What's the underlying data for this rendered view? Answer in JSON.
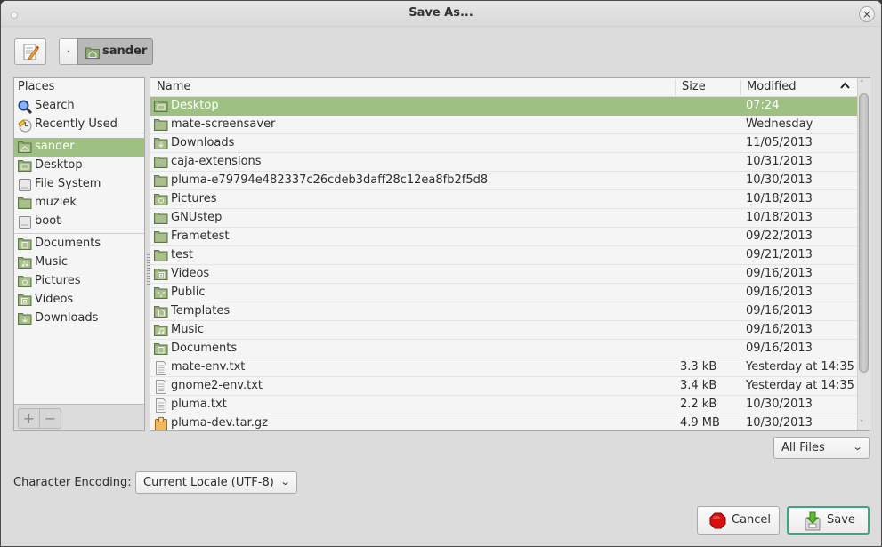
{
  "window": {
    "title": "Save As..."
  },
  "path_bar": {
    "back_label": "‹",
    "current_folder": "sander"
  },
  "places": {
    "header": "Places",
    "items": [
      {
        "label": "Search",
        "icon": "search-icon",
        "selected": false
      },
      {
        "label": "Recently Used",
        "icon": "recent-icon",
        "selected": false
      },
      {
        "label": "sander",
        "icon": "home-folder-icon",
        "selected": true
      },
      {
        "label": "Desktop",
        "icon": "desktop-folder-icon",
        "selected": false
      },
      {
        "label": "File System",
        "icon": "drive-icon",
        "selected": false
      },
      {
        "label": "muziek",
        "icon": "folder-icon",
        "selected": false
      },
      {
        "label": "boot",
        "icon": "drive-icon",
        "selected": false
      },
      {
        "label": "Documents",
        "icon": "documents-folder-icon",
        "selected": false
      },
      {
        "label": "Music",
        "icon": "music-folder-icon",
        "selected": false
      },
      {
        "label": "Pictures",
        "icon": "pictures-folder-icon",
        "selected": false
      },
      {
        "label": "Videos",
        "icon": "videos-folder-icon",
        "selected": false
      },
      {
        "label": "Downloads",
        "icon": "downloads-folder-icon",
        "selected": false
      }
    ],
    "add_label": "+",
    "remove_label": "−"
  },
  "file_list": {
    "columns": {
      "name": "Name",
      "size": "Size",
      "modified": "Modified"
    },
    "sort_indicator": "^",
    "rows": [
      {
        "name": "Desktop",
        "size": "",
        "modified": "07:24",
        "icon": "desktop-folder-icon",
        "selected": true
      },
      {
        "name": "mate-screensaver",
        "size": "",
        "modified": "Wednesday",
        "icon": "folder-icon",
        "selected": false
      },
      {
        "name": "Downloads",
        "size": "",
        "modified": "11/05/2013",
        "icon": "downloads-folder-icon",
        "selected": false
      },
      {
        "name": "caja-extensions",
        "size": "",
        "modified": "10/31/2013",
        "icon": "folder-icon",
        "selected": false
      },
      {
        "name": "pluma-e79794e482337c26cdeb3daff28c12ea8fb2f5d8",
        "size": "",
        "modified": "10/30/2013",
        "icon": "folder-icon",
        "selected": false
      },
      {
        "name": "Pictures",
        "size": "",
        "modified": "10/18/2013",
        "icon": "pictures-folder-icon",
        "selected": false
      },
      {
        "name": "GNUstep",
        "size": "",
        "modified": "10/18/2013",
        "icon": "folder-icon",
        "selected": false
      },
      {
        "name": "Frametest",
        "size": "",
        "modified": "09/22/2013",
        "icon": "folder-icon",
        "selected": false
      },
      {
        "name": "test",
        "size": "",
        "modified": "09/21/2013",
        "icon": "folder-icon",
        "selected": false
      },
      {
        "name": "Videos",
        "size": "",
        "modified": "09/16/2013",
        "icon": "videos-folder-icon",
        "selected": false
      },
      {
        "name": "Public",
        "size": "",
        "modified": "09/16/2013",
        "icon": "public-folder-icon",
        "selected": false
      },
      {
        "name": "Templates",
        "size": "",
        "modified": "09/16/2013",
        "icon": "templates-folder-icon",
        "selected": false
      },
      {
        "name": "Music",
        "size": "",
        "modified": "09/16/2013",
        "icon": "music-folder-icon",
        "selected": false
      },
      {
        "name": "Documents",
        "size": "",
        "modified": "09/16/2013",
        "icon": "documents-folder-icon",
        "selected": false
      },
      {
        "name": "mate-env.txt",
        "size": "3.3 kB",
        "modified": "Yesterday at 14:35",
        "icon": "text-file-icon",
        "selected": false
      },
      {
        "name": "gnome2-env.txt",
        "size": "3.4 kB",
        "modified": "Yesterday at 14:35",
        "icon": "text-file-icon",
        "selected": false
      },
      {
        "name": "pluma.txt",
        "size": "2.2 kB",
        "modified": "10/30/2013",
        "icon": "text-file-icon",
        "selected": false
      },
      {
        "name": "pluma-dev.tar.gz",
        "size": "4.9 MB",
        "modified": "10/30/2013",
        "icon": "archive-icon",
        "selected": false
      }
    ]
  },
  "filter": {
    "selected": "All Files"
  },
  "encoding": {
    "label": "Character Encoding:",
    "selected": "Current Locale (UTF-8)"
  },
  "buttons": {
    "cancel": "Cancel",
    "save": "Save"
  },
  "colors": {
    "selection": "#9ec183",
    "folder": "#8fa874",
    "save_border": "#39a97a"
  }
}
